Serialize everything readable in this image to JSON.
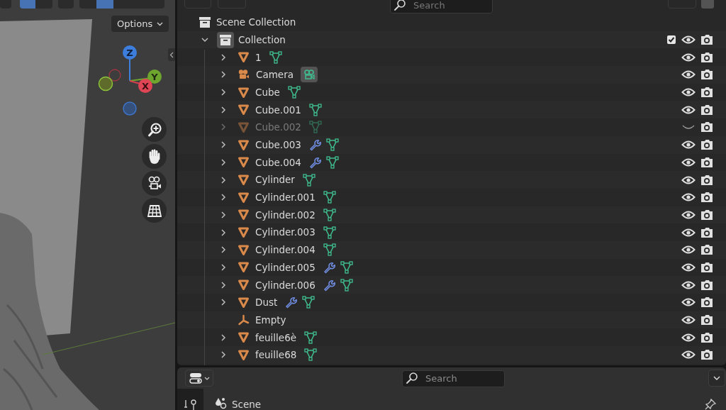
{
  "viewport": {
    "options_label": "Options",
    "gizmo": {
      "z": "Z",
      "y": "Y",
      "x": "X"
    }
  },
  "outliner": {
    "search": {
      "placeholder": "Search"
    },
    "scene_collection": "Scene Collection",
    "collection": {
      "name": "Collection",
      "expanded": true,
      "checked": true
    },
    "items": [
      {
        "name": "1",
        "kind": "mesh",
        "expandable": true,
        "visible": true,
        "modifier": false,
        "data_icon": true
      },
      {
        "name": "Camera",
        "kind": "camera",
        "expandable": true,
        "visible": true,
        "modifier": false,
        "data_icon": true
      },
      {
        "name": "Cube",
        "kind": "mesh",
        "expandable": true,
        "visible": true,
        "modifier": false,
        "data_icon": true
      },
      {
        "name": "Cube.001",
        "kind": "mesh",
        "expandable": true,
        "visible": true,
        "modifier": false,
        "data_icon": true
      },
      {
        "name": "Cube.002",
        "kind": "mesh",
        "expandable": true,
        "visible": false,
        "modifier": false,
        "data_icon": true
      },
      {
        "name": "Cube.003",
        "kind": "mesh",
        "expandable": true,
        "visible": true,
        "modifier": true,
        "data_icon": true
      },
      {
        "name": "Cube.004",
        "kind": "mesh",
        "expandable": true,
        "visible": true,
        "modifier": true,
        "data_icon": true
      },
      {
        "name": "Cylinder",
        "kind": "mesh",
        "expandable": true,
        "visible": true,
        "modifier": false,
        "data_icon": true
      },
      {
        "name": "Cylinder.001",
        "kind": "mesh",
        "expandable": true,
        "visible": true,
        "modifier": false,
        "data_icon": true
      },
      {
        "name": "Cylinder.002",
        "kind": "mesh",
        "expandable": true,
        "visible": true,
        "modifier": false,
        "data_icon": true
      },
      {
        "name": "Cylinder.003",
        "kind": "mesh",
        "expandable": true,
        "visible": true,
        "modifier": false,
        "data_icon": true
      },
      {
        "name": "Cylinder.004",
        "kind": "mesh",
        "expandable": true,
        "visible": true,
        "modifier": false,
        "data_icon": true
      },
      {
        "name": "Cylinder.005",
        "kind": "mesh",
        "expandable": true,
        "visible": true,
        "modifier": true,
        "data_icon": true
      },
      {
        "name": "Cylinder.006",
        "kind": "mesh",
        "expandable": true,
        "visible": true,
        "modifier": true,
        "data_icon": true
      },
      {
        "name": "Dust",
        "kind": "mesh",
        "expandable": true,
        "visible": true,
        "modifier": true,
        "data_icon": true
      },
      {
        "name": "Empty",
        "kind": "empty",
        "expandable": false,
        "visible": true,
        "modifier": false,
        "data_icon": false
      },
      {
        "name": "feuille6è",
        "kind": "mesh",
        "expandable": true,
        "visible": true,
        "modifier": false,
        "data_icon": true
      },
      {
        "name": "feuille68",
        "kind": "mesh",
        "expandable": true,
        "visible": true,
        "modifier": false,
        "data_icon": true
      }
    ]
  },
  "properties": {
    "search": {
      "placeholder": "Search"
    },
    "context": "Scene"
  }
}
